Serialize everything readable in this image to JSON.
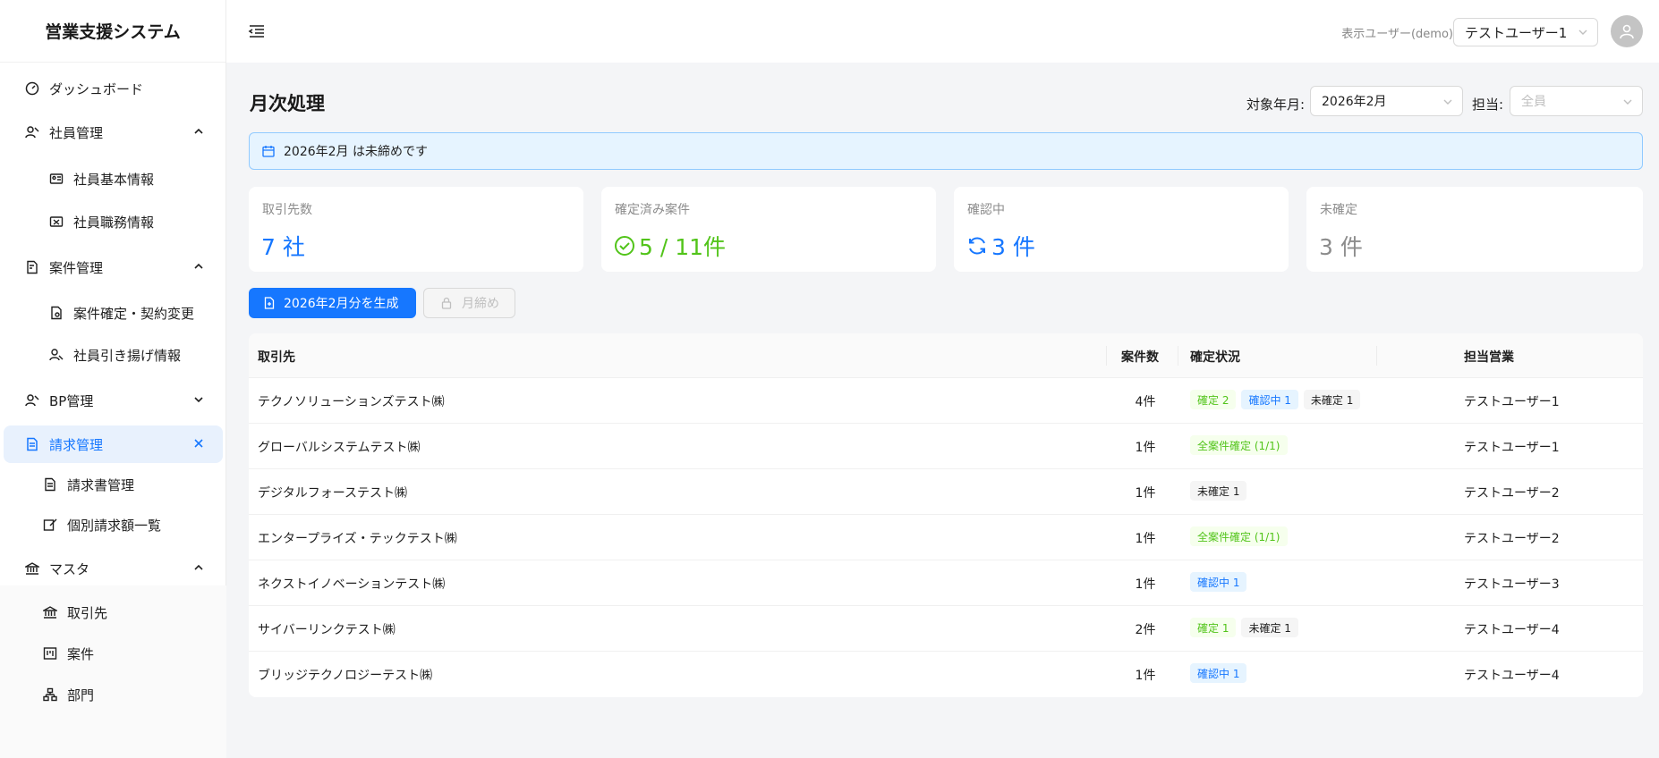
{
  "app": {
    "brand": "営業支援システム"
  },
  "sidebar": {
    "items": [
      {
        "label": "ダッシュボード"
      },
      {
        "label": "社員管理"
      },
      {
        "label": "社員基本情報"
      },
      {
        "label": "社員職務情報"
      },
      {
        "label": "案件管理"
      },
      {
        "label": "案件確定・契約変更"
      },
      {
        "label": "社員引き揚げ情報"
      },
      {
        "label": "BP管理"
      },
      {
        "label": "請求管理"
      },
      {
        "label": "請求書管理"
      },
      {
        "label": "個別請求額一覧"
      },
      {
        "label": "マスタ"
      },
      {
        "label": "取引先"
      },
      {
        "label": "案件"
      },
      {
        "label": "部門"
      }
    ]
  },
  "header": {
    "user_label": "表示ユーザー(demo)",
    "user_selected": "テストユーザー1"
  },
  "main": {
    "title": "月次処理",
    "filters": {
      "month_label": "対象年月:",
      "month_value": "2026年2月",
      "owner_label": "担当:",
      "owner_placeholder": "全員"
    },
    "alert": "2026年2月 は未締めです",
    "stats": [
      {
        "label": "取引先数",
        "value": "7 社",
        "color": "#1677ff"
      },
      {
        "label": "確定済み案件",
        "value": "5 / 11件",
        "color": "#52c41a"
      },
      {
        "label": "確認中",
        "value": "3 件",
        "color": "#1677ff"
      },
      {
        "label": "未確定",
        "value": "3 件",
        "color": "#8c8c8c"
      }
    ],
    "buttons": {
      "generate": "2026年2月分を生成",
      "close_month": "月締め"
    },
    "table": {
      "headers": {
        "client": "取引先",
        "count": "案件数",
        "status": "確定状況",
        "sales": "担当営業"
      },
      "rows": [
        {
          "client": "テクノソリューションズテスト㈱",
          "count": "4件",
          "tags": [
            {
              "text": "確定 2",
              "type": "green"
            },
            {
              "text": "確認中 1",
              "type": "blue"
            },
            {
              "text": "未確定 1",
              "type": "gray"
            }
          ],
          "sales": "テストユーザー1"
        },
        {
          "client": "グローバルシステムテスト㈱",
          "count": "1件",
          "tags": [
            {
              "text": "全案件確定 (1/1)",
              "type": "green"
            }
          ],
          "sales": "テストユーザー1"
        },
        {
          "client": "デジタルフォーステスト㈱",
          "count": "1件",
          "tags": [
            {
              "text": "未確定 1",
              "type": "gray"
            }
          ],
          "sales": "テストユーザー2"
        },
        {
          "client": "エンタープライズ・テックテスト㈱",
          "count": "1件",
          "tags": [
            {
              "text": "全案件確定 (1/1)",
              "type": "green"
            }
          ],
          "sales": "テストユーザー2"
        },
        {
          "client": "ネクストイノベーションテスト㈱",
          "count": "1件",
          "tags": [
            {
              "text": "確認中 1",
              "type": "blue"
            }
          ],
          "sales": "テストユーザー3"
        },
        {
          "client": "サイバーリンクテスト㈱",
          "count": "2件",
          "tags": [
            {
              "text": "確定 1",
              "type": "green"
            },
            {
              "text": "未確定 1",
              "type": "gray"
            }
          ],
          "sales": "テストユーザー4"
        },
        {
          "client": "ブリッジテクノロジーテスト㈱",
          "count": "1件",
          "tags": [
            {
              "text": "確認中 1",
              "type": "blue"
            }
          ],
          "sales": "テストユーザー4"
        }
      ]
    }
  }
}
